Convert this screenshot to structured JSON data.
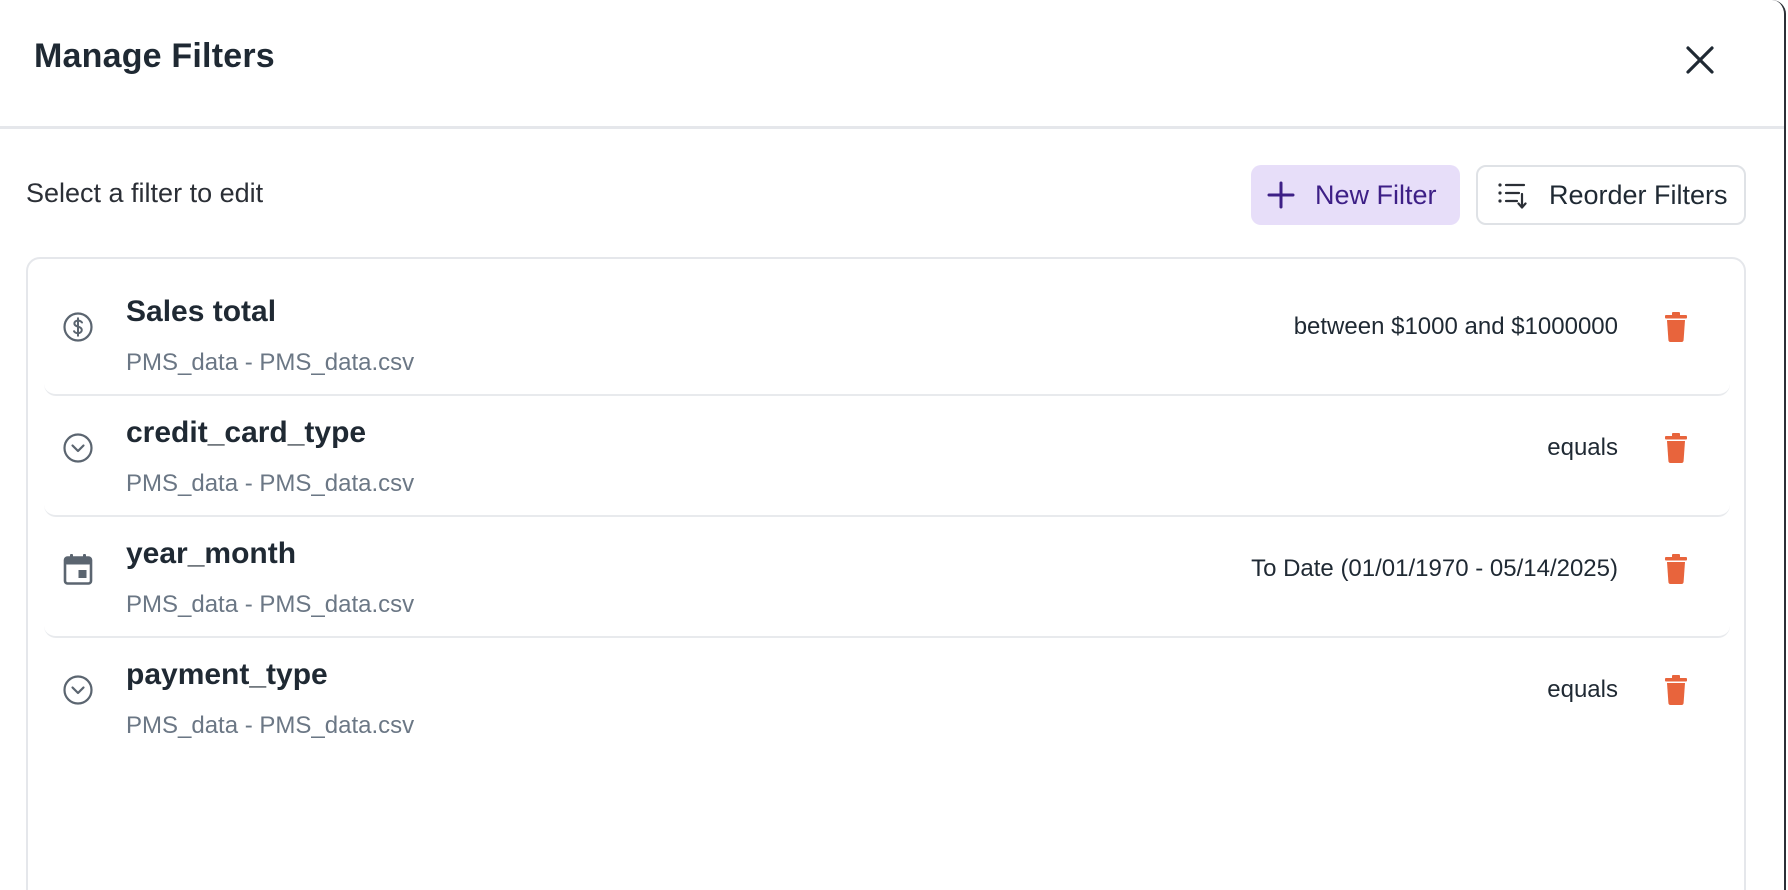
{
  "dialog": {
    "title": "Manage Filters",
    "close_icon": "close-icon"
  },
  "toolbar": {
    "subtitle": "Select a filter to edit",
    "new_filter_label": "New Filter",
    "new_filter_icon": "plus-icon",
    "reorder_label": "Reorder Filters",
    "reorder_icon": "reorder-list-icon"
  },
  "colors": {
    "accent_bg": "#e7def9",
    "accent_text": "#3d1f86",
    "delete": "#e8643c",
    "icon_gray": "#5b6570"
  },
  "filters": [
    {
      "name": "Sales total",
      "source": "PMS_data - PMS_data.csv",
      "condition": "between $1000 and $1000000",
      "icon": "currency-icon"
    },
    {
      "name": "credit_card_type",
      "source": "PMS_data - PMS_data.csv",
      "condition": "equals",
      "icon": "chevron-circle-down-icon"
    },
    {
      "name": "year_month",
      "source": "PMS_data - PMS_data.csv",
      "condition": "To Date (01/01/1970 - 05/14/2025)",
      "icon": "calendar-icon"
    },
    {
      "name": "payment_type",
      "source": "PMS_data - PMS_data.csv",
      "condition": "equals",
      "icon": "chevron-circle-down-icon"
    }
  ]
}
